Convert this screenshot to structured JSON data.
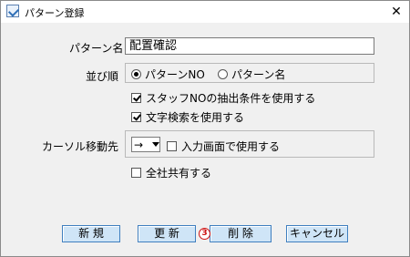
{
  "window": {
    "title": "パターン登録",
    "close_glyph": "✕"
  },
  "pattern_name": {
    "label": "パターン名",
    "value": "配置確認"
  },
  "sort_order": {
    "label": "並び順",
    "options": [
      {
        "label": "パターンNO",
        "selected": true
      },
      {
        "label": "パターン名",
        "selected": false
      }
    ]
  },
  "checkboxes": {
    "staff_no": {
      "label": "スタッフNOの抽出条件を使用する",
      "checked": true
    },
    "text_search": {
      "label": "文字検索を使用する",
      "checked": true
    },
    "input_screen": {
      "label": "入力画面で使用する",
      "checked": false
    },
    "shared": {
      "label": "全社共有する",
      "checked": false
    }
  },
  "cursor_move": {
    "label": "カーソル移動先",
    "selected_value": "→"
  },
  "buttons": {
    "new": "新 規",
    "update": "更 新",
    "delete": "削 除",
    "cancel": "キャンセル"
  },
  "annotation": {
    "badge": "3"
  },
  "colors": {
    "button_bg": "#cfe5f7",
    "button_border": "#3f7fbf",
    "badge": "#cc1010"
  }
}
